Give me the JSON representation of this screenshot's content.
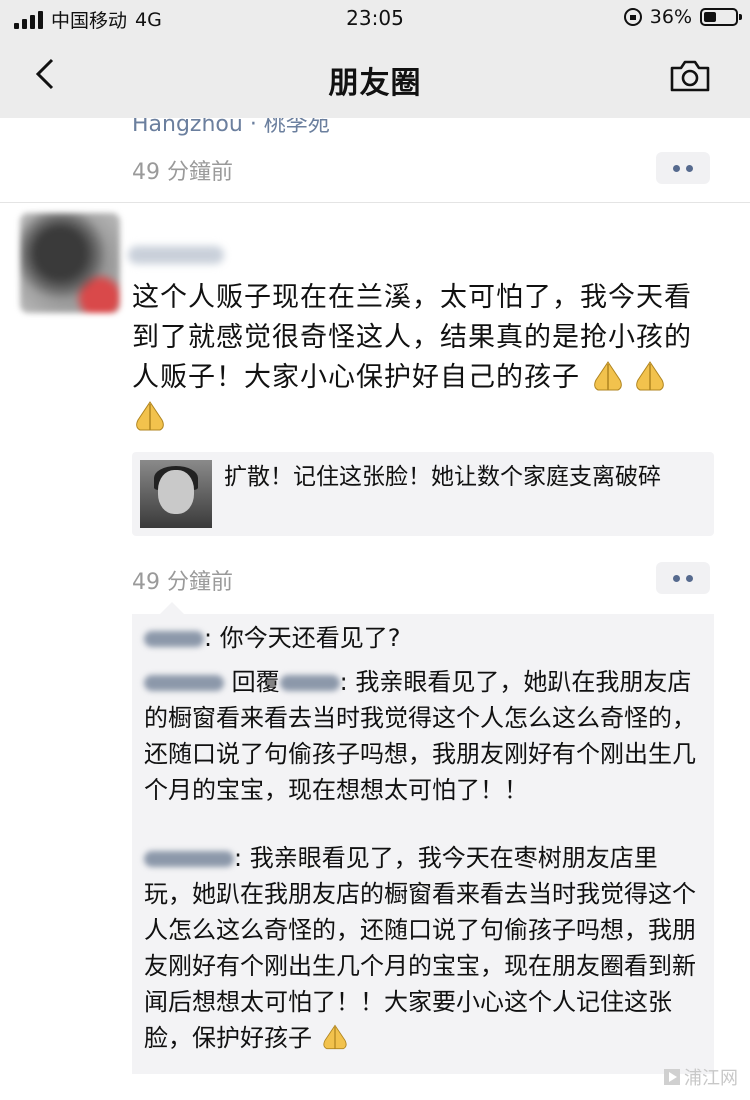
{
  "status_bar": {
    "carrier": "中国移动",
    "network": "4G",
    "time": "23:05",
    "battery": "36%"
  },
  "nav": {
    "title": "朋友圈",
    "back_icon": "chevron-left-icon",
    "camera_icon": "camera-icon"
  },
  "previous_post": {
    "location": "Hangzhou · 桃李苑",
    "time": "49 分鐘前"
  },
  "post": {
    "text": "这个人贩子现在在兰溪，太可怕了，我今天看到了就感觉很奇怪这人，结果真的是抢小孩的人贩子！大家小心保护好自己的孩子",
    "emoji": "🙏",
    "shared_link": {
      "title": "扩散！记住这张脸！她让数个家庭支离破碎"
    },
    "time": "49 分鐘前"
  },
  "comments": [
    {
      "text": ": 你今天还看见了?"
    },
    {
      "reply_prefix": "回覆",
      "text": ": 我亲眼看见了，她趴在我朋友店的橱窗看来看去当时我觉得这个人怎么这么奇怪的，还随口说了句偷孩子吗想，我朋友刚好有个刚出生几个月的宝宝，现在想想太可怕了！！"
    },
    {
      "text": ": 我亲眼看见了，我今天在枣树朋友店里玩，她趴在我朋友店的橱窗看来看去当时我觉得这个人怎么这么奇怪的，还随口说了句偷孩子吗想，我朋友刚好有个刚出生几个月的宝宝，现在朋友圈看到新闻后想想太可怕了！！大家要小心这个人记住这张脸，保护好孩子"
    }
  ],
  "watermark": "浦江网",
  "colors": {
    "link_blue": "#566a8e",
    "time_gray": "#9a9a9a",
    "comment_bg": "#f3f3f5"
  }
}
